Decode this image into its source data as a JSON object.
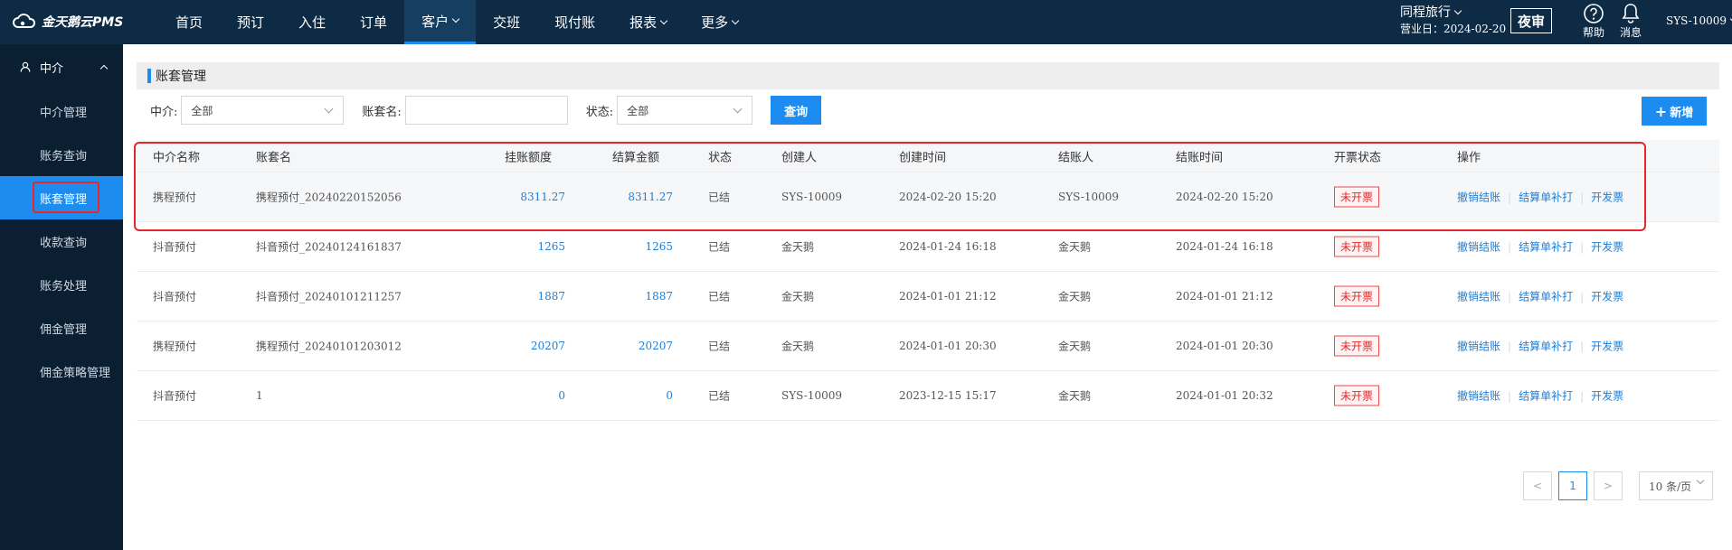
{
  "app": {
    "logo_text": "金天鹅云PMS"
  },
  "nav": {
    "items": [
      {
        "label": "首页",
        "has_dropdown": false
      },
      {
        "label": "预订",
        "has_dropdown": false
      },
      {
        "label": "入住",
        "has_dropdown": false
      },
      {
        "label": "订单",
        "has_dropdown": false
      },
      {
        "label": "客户",
        "has_dropdown": true,
        "active": true
      },
      {
        "label": "交班",
        "has_dropdown": false
      },
      {
        "label": "现付账",
        "has_dropdown": false
      },
      {
        "label": "报表",
        "has_dropdown": true
      },
      {
        "label": "更多",
        "has_dropdown": true
      }
    ]
  },
  "header": {
    "hotel_name": "同程旅行",
    "business_date_label": "营业日：2024-02-20",
    "night_audit_label": "夜审",
    "help_label": "帮助",
    "message_label": "消息",
    "user_label": "SYS-10009"
  },
  "sidebar": {
    "group_label": "中介",
    "items": [
      {
        "label": "中介管理"
      },
      {
        "label": "账务查询"
      },
      {
        "label": "账套管理",
        "active": true
      },
      {
        "label": "收款查询"
      },
      {
        "label": "账务处理"
      },
      {
        "label": "佣金管理"
      },
      {
        "label": "佣金策略管理"
      }
    ]
  },
  "page": {
    "title": "账套管理",
    "filters": {
      "agent_label": "中介:",
      "agent_value": "全部",
      "account_set_label": "账套名:",
      "account_set_value": "",
      "status_label": "状态:",
      "status_value": "全部",
      "query_button": "查询"
    },
    "add_button": "新增"
  },
  "table": {
    "columns": [
      "中介名称",
      "账套名",
      "挂账额度",
      "结算金额",
      "状态",
      "创建人",
      "创建时间",
      "结账人",
      "结账时间",
      "开票状态",
      "操作"
    ],
    "rows": [
      {
        "agent": "携程预付",
        "account_set": "携程预付_20240220152056",
        "credit": "8311.27",
        "settle": "8311.27",
        "status": "已结",
        "creator": "SYS-10009",
        "created": "2024-02-20 15:20",
        "closer": "SYS-10009",
        "closed": "2024-02-20 15:20",
        "invoice": "未开票"
      },
      {
        "agent": "抖音预付",
        "account_set": "抖音预付_20240124161837",
        "credit": "1265",
        "settle": "1265",
        "status": "已结",
        "creator": "金天鹅",
        "created": "2024-01-24 16:18",
        "closer": "金天鹅",
        "closed": "2024-01-24 16:18",
        "invoice": "未开票"
      },
      {
        "agent": "抖音预付",
        "account_set": "抖音预付_20240101211257",
        "credit": "1887",
        "settle": "1887",
        "status": "已结",
        "creator": "金天鹅",
        "created": "2024-01-01 21:12",
        "closer": "金天鹅",
        "closed": "2024-01-01 21:12",
        "invoice": "未开票"
      },
      {
        "agent": "携程预付",
        "account_set": "携程预付_20240101203012",
        "credit": "20207",
        "settle": "20207",
        "status": "已结",
        "creator": "金天鹅",
        "created": "2024-01-01 20:30",
        "closer": "金天鹅",
        "closed": "2024-01-01 20:30",
        "invoice": "未开票"
      },
      {
        "agent": "抖音预付",
        "account_set": "1",
        "credit": "0",
        "settle": "0",
        "status": "已结",
        "creator": "SYS-10009",
        "created": "2023-12-15 15:17",
        "closer": "金天鹅",
        "closed": "2024-01-01 20:32",
        "invoice": "未开票"
      }
    ],
    "actions": [
      "撤销结账",
      "结算单补打",
      "开发票"
    ]
  },
  "pagination": {
    "prev": "<",
    "current_page": "1",
    "next": ">",
    "page_size": "10 条/页"
  },
  "colors": {
    "topbar": "#0e2b45",
    "sidebar": "#0b1f33",
    "accent": "#1c8cf0",
    "highlight": "#e5262a"
  }
}
